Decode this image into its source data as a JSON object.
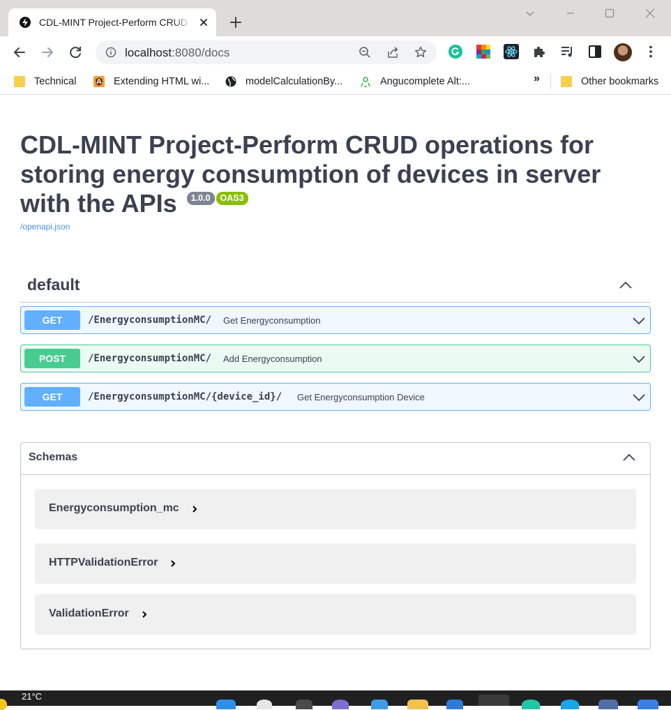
{
  "browser": {
    "tab_title": "CDL-MINT Project-Perform CRUD operations for storing energy consumption of devices in server with the APIs",
    "url_host": "localhost",
    "url_path": ":8080/docs",
    "bookmarks": [
      {
        "label": "Technical",
        "icon": "folder-icon"
      },
      {
        "label": "Extending HTML wi...",
        "icon": "angularjs-icon"
      },
      {
        "label": "modelCalculationBy...",
        "icon": "globe-icon"
      },
      {
        "label": "Angucomplete Alt:...",
        "icon": "angucomplete-icon"
      }
    ],
    "more_bookmarks": "»",
    "other_bookmarks": "Other bookmarks"
  },
  "api": {
    "title": "CDL-MINT Project-Perform CRUD operations for storing energy consumption of devices in server with the APIs",
    "version": "1.0.0",
    "oas_badge": "OAS3",
    "spec_link": "/openapi.json"
  },
  "section": {
    "name": "default",
    "operations": [
      {
        "method": "GET",
        "path": "/EnergyconsumptionMC/",
        "summary": "Get Energyconsumption"
      },
      {
        "method": "POST",
        "path": "/EnergyconsumptionMC/",
        "summary": "Add Energyconsumption"
      },
      {
        "method": "GET",
        "path": "/EnergyconsumptionMC/{device_id}/",
        "summary": "Get Energyconsumption Device"
      }
    ]
  },
  "schemas": {
    "title": "Schemas",
    "models": [
      "Energyconsumption_mc",
      "HTTPValidationError",
      "ValidationError"
    ]
  },
  "taskbar": {
    "temperature": "21°C"
  },
  "colors": {
    "get": "#61affe",
    "post": "#49cc90",
    "text": "#3b4151",
    "link": "#4990e2",
    "tabstrip": "#dfdbd8"
  }
}
